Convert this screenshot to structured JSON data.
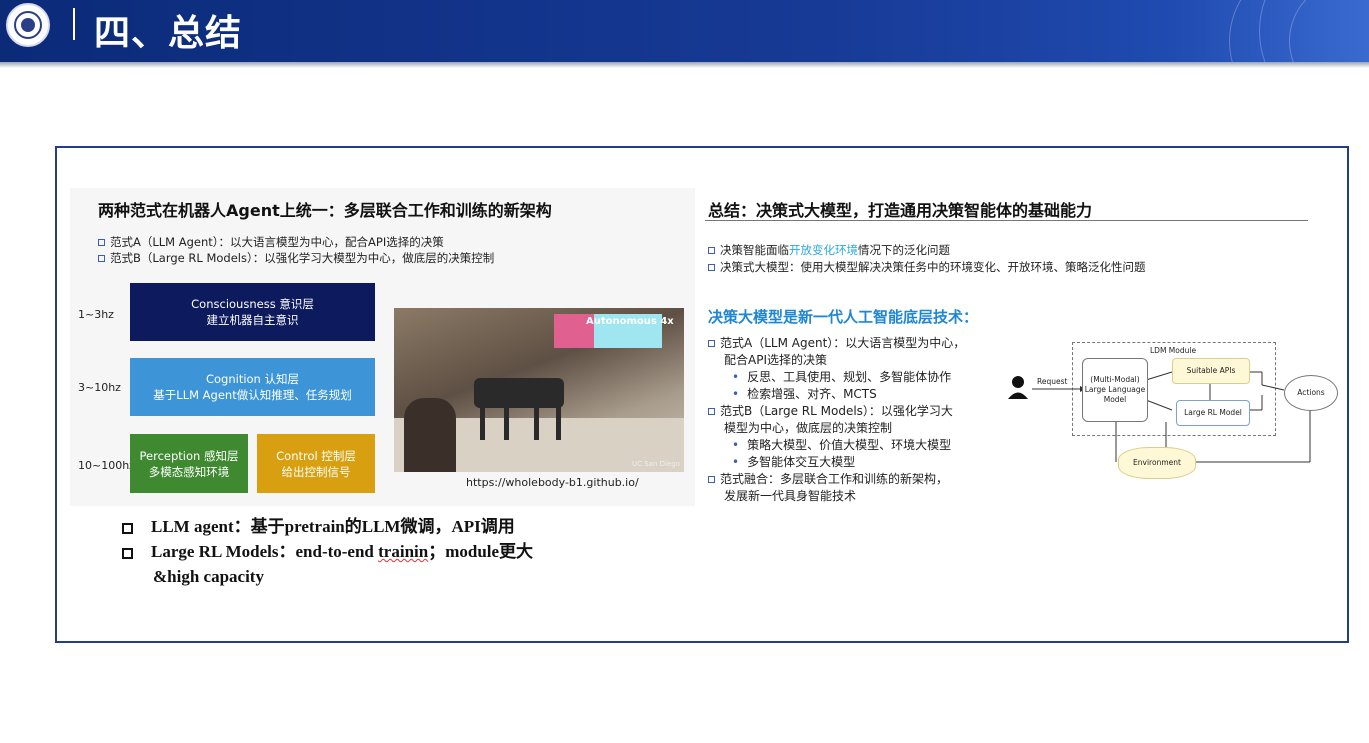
{
  "header": {
    "title": "四、总结",
    "colors": {
      "bar": "#173a96",
      "accent": "#1e86d6"
    }
  },
  "left_panel": {
    "title": "两种范式在机器人Agent上统一：多层联合工作和训练的新架构",
    "bullets": [
      "范式A（LLM Agent）：以大语言模型为中心，配合API选择的决策",
      "范式B（Large RL Models）：以强化学习大模型为中心，做底层的决策控制"
    ],
    "freqs": [
      "1~3hz",
      "3~10hz",
      "10~100hz"
    ],
    "blocks": {
      "consciousness": {
        "line1": "Consciousness 意识层",
        "line2": "建立机器自主意识"
      },
      "cognition": {
        "line1": "Cognition 认知层",
        "line2": "基于LLM Agent做认知推理、任务规划"
      },
      "perception": {
        "line1": "Perception 感知层",
        "line2": "多模态感知环境"
      },
      "control": {
        "line1": "Control 控制层",
        "line2": "给出控制信号"
      }
    },
    "photo": {
      "badge": "Autonomous 4x",
      "caption": "UC San Diego"
    },
    "url": "https://wholebody-b1.github.io/"
  },
  "right_panel": {
    "title": "总结：决策式大模型，打造通用决策智能体的基础能力",
    "bullet1_pre": "决策智能面临",
    "bullet1_hl": "开放变化环境",
    "bullet1_post": "情况下的泛化问题",
    "bullet2": "决策式大模型：使用大模型解决决策任务中的环境变化、开放环境、策略泛化性问题",
    "subheading": "决策大模型是新一代人工智能底层技术：",
    "items": [
      {
        "kind": "sq",
        "text": "范式A（LLM Agent）：以大语言模型为中心，"
      },
      {
        "kind": "cont",
        "text": "配合API选择的决策"
      },
      {
        "kind": "dot",
        "text": "反思、工具使用、规划、多智能体协作"
      },
      {
        "kind": "dot",
        "text": "检索增强、对齐、MCTS"
      },
      {
        "kind": "sq",
        "text": "范式B（Large RL Models）：以强化学习大"
      },
      {
        "kind": "cont",
        "text": "模型为中心，做底层的决策控制"
      },
      {
        "kind": "dot",
        "text": "策略大模型、价值大模型、环境大模型"
      },
      {
        "kind": "dot",
        "text": "多智能体交互大模型"
      },
      {
        "kind": "sq",
        "text": "范式融合：多层联合工作和训练的新架构，"
      },
      {
        "kind": "cont",
        "text": "发展新一代具身智能技术"
      }
    ],
    "diagram": {
      "module": "LDM Module",
      "request": "Request",
      "llm": "(Multi-Modal) Large Language Model",
      "apis": "Suitable APIs",
      "rl": "Large RL Model",
      "actions": "Actions",
      "environment": "Environment"
    }
  },
  "bottom": {
    "line1": "LLM agent：基于pretrain的LLM微调，API调用",
    "line2_a": "Large RL Models：end-to-end ",
    "line2_b": "trainin",
    "line2_c": "；module更大",
    "line3": "&high capacity"
  }
}
